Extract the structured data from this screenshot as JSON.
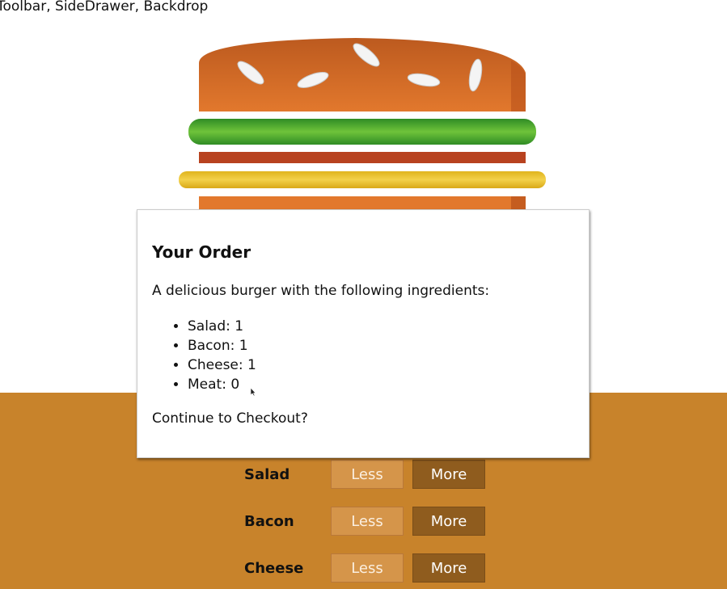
{
  "header": {
    "text": "Toolbar, SideDrawer, Backdrop"
  },
  "modal": {
    "title": "Your Order",
    "description": "A delicious burger with the following ingredients:",
    "ingredients": [
      {
        "label": "Salad: 1"
      },
      {
        "label": "Bacon: 1"
      },
      {
        "label": "Cheese: 1"
      },
      {
        "label": "Meat: 0"
      }
    ],
    "question": "Continue to Checkout?"
  },
  "controls": [
    {
      "label": "Salad",
      "less": "Less",
      "more": "More"
    },
    {
      "label": "Bacon",
      "less": "Less",
      "more": "More"
    },
    {
      "label": "Cheese",
      "less": "Less",
      "more": "More"
    }
  ],
  "colors": {
    "controls_bg": "#c8832b",
    "more_button": "#8f5c1e",
    "less_button": "#d5954a",
    "bun": "#d2691e",
    "salad": "#4caf2a",
    "cheese": "#f2c62a",
    "bacon": "#b8421f"
  }
}
